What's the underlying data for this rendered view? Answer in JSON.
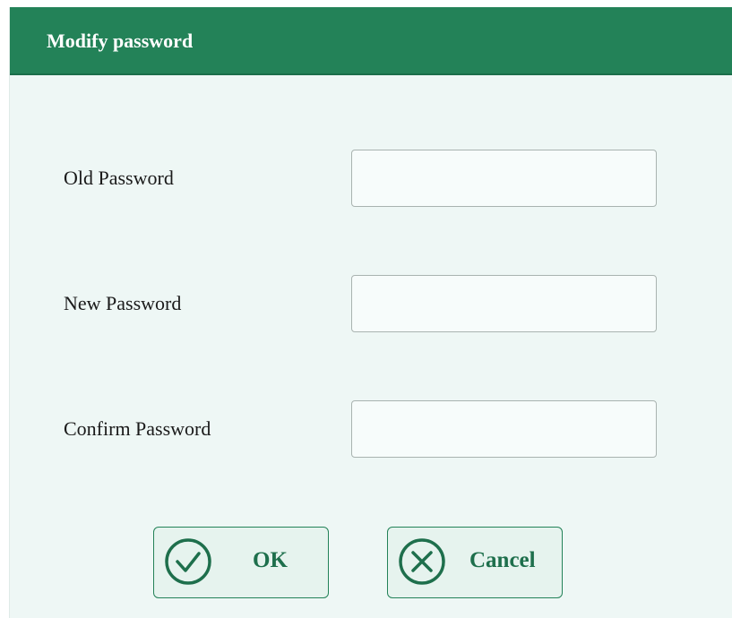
{
  "dialog": {
    "title": "Modify password"
  },
  "fields": [
    {
      "label": "Old Password",
      "value": ""
    },
    {
      "label": "New Password",
      "value": ""
    },
    {
      "label": "Confirm Password",
      "value": ""
    }
  ],
  "buttons": {
    "ok": {
      "label": "OK",
      "icon": "check-circle-icon"
    },
    "cancel": {
      "label": "Cancel",
      "icon": "x-circle-icon"
    }
  },
  "colors": {
    "titlebar": "#238258",
    "background": "#eef7f5",
    "accent": "#1e6f4c"
  }
}
